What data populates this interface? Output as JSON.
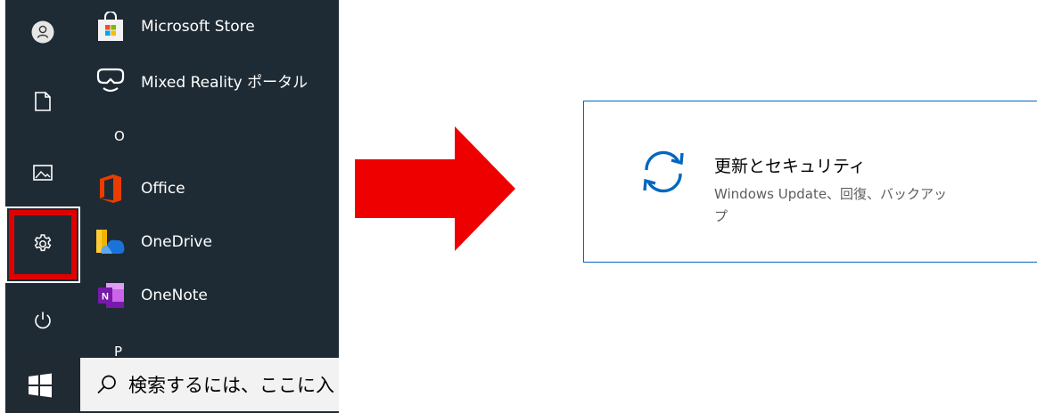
{
  "start_menu": {
    "apps": [
      {
        "name": "Microsoft Store",
        "icon": "microsoft-store-icon"
      },
      {
        "name": "Mixed Reality ポータル",
        "icon": "mixed-reality-icon"
      },
      {
        "name": "Office",
        "icon": "office-icon"
      },
      {
        "name": "OneDrive",
        "icon": "onedrive-icon"
      },
      {
        "name": "OneNote",
        "icon": "onenote-icon"
      }
    ],
    "section_letters": [
      "O",
      "P"
    ],
    "rail_icons": [
      "user-avatar-icon",
      "documents-icon",
      "pictures-icon",
      "settings-gear-icon",
      "power-icon"
    ],
    "highlight_color": "#e00000"
  },
  "taskbar": {
    "search_placeholder": "検索するには、ここに入",
    "start_icon": "windows-logo-icon"
  },
  "arrow": {
    "color": "#ee0000",
    "icon": "right-arrow"
  },
  "settings_card": {
    "title": "更新とセキュリティ",
    "description": "Windows Update、回復、バックアップ",
    "icon": "sync-arrows-icon",
    "accent": "#0067c0"
  }
}
